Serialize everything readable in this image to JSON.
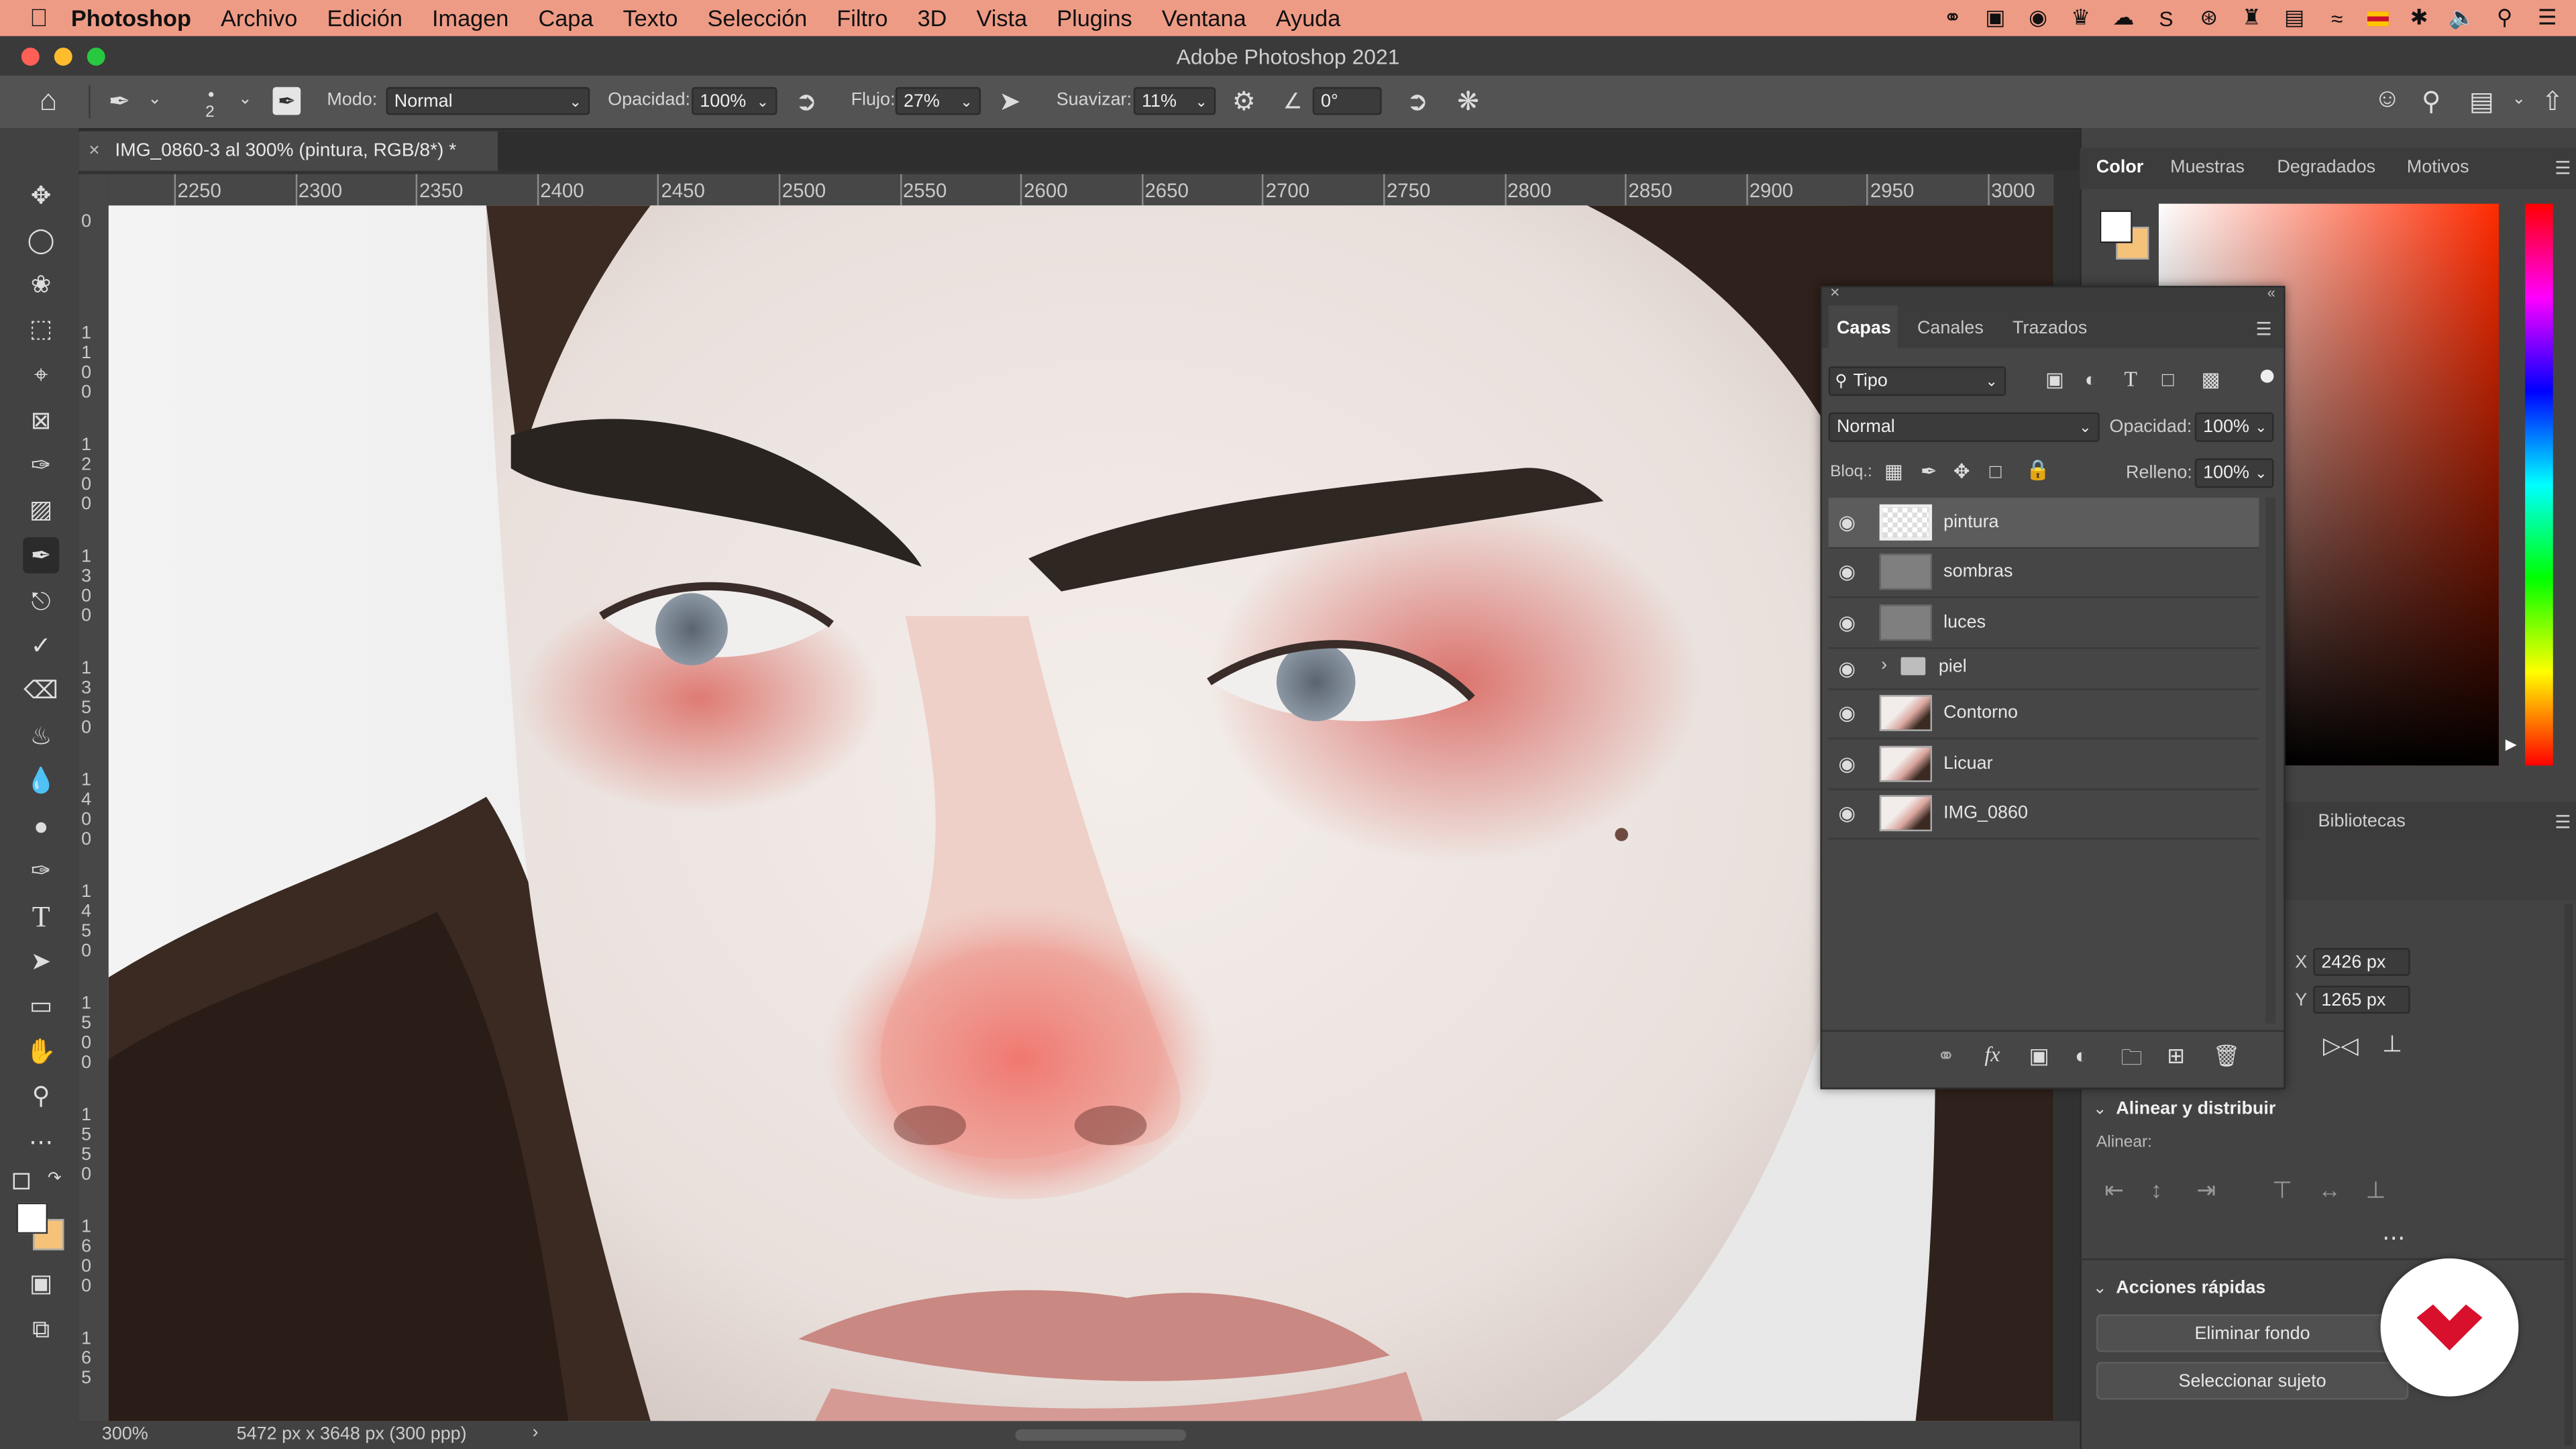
{
  "menubar": {
    "app_name": "Photoshop",
    "items": [
      "Archivo",
      "Edición",
      "Imagen",
      "Capa",
      "Texto",
      "Selección",
      "Filtro",
      "3D",
      "Vista",
      "Plugins",
      "Ventana",
      "Ayuda"
    ]
  },
  "window": {
    "title": "Adobe Photoshop 2021"
  },
  "options": {
    "brush_size": "2",
    "mode_label": "Modo:",
    "mode_value": "Normal",
    "opacity_label": "Opacidad:",
    "opacity_value": "100%",
    "flow_label": "Flujo:",
    "flow_value": "27%",
    "smoothing_label": "Suavizar:",
    "smoothing_value": "11%",
    "angle_value": "0°"
  },
  "document": {
    "tab_title": "IMG_0860-3 al 300% (pintura, RGB/8*) *",
    "zoom": "300%",
    "dimensions": "5472 px x 3648 px (300 ppp)"
  },
  "ruler": {
    "h_labels": [
      "2250",
      "2300",
      "2350",
      "2400",
      "2450",
      "2500",
      "2550",
      "2600",
      "2650",
      "2700",
      "2750",
      "2800",
      "2850",
      "2900",
      "2950",
      "3000"
    ],
    "v_labels": [
      [
        "0"
      ],
      [
        "1",
        "1",
        "0",
        "0"
      ],
      [
        "1",
        "2",
        "0",
        "0"
      ],
      [
        "1",
        "3",
        "0",
        "0"
      ],
      [
        "1",
        "3",
        "5",
        "0"
      ],
      [
        "1",
        "4",
        "0",
        "0"
      ],
      [
        "1",
        "4",
        "5",
        "0"
      ],
      [
        "1",
        "5",
        "0",
        "0"
      ],
      [
        "1",
        "5",
        "5",
        "0"
      ],
      [
        "1",
        "6",
        "0",
        "0"
      ],
      [
        "1",
        "6",
        "5"
      ]
    ]
  },
  "color_panel": {
    "tabs": [
      "Color",
      "Muestras",
      "Degradados",
      "Motivos"
    ],
    "foreground": "#ffffff",
    "background": "#f5c27a"
  },
  "layers_panel": {
    "tabs": [
      "Capas",
      "Canales",
      "Trazados"
    ],
    "filter_label": "Tipo",
    "blend_mode": "Normal",
    "opacity_label": "Opacidad:",
    "opacity_value": "100%",
    "lock_label": "Bloq.:",
    "fill_label": "Relleno:",
    "fill_value": "100%",
    "layers": [
      {
        "name": "pintura",
        "kind": "transparent",
        "selected": true
      },
      {
        "name": "sombras",
        "kind": "gray",
        "selected": false
      },
      {
        "name": "luces",
        "kind": "gray",
        "selected": false
      },
      {
        "name": "piel",
        "kind": "group",
        "selected": false
      },
      {
        "name": "Contorno",
        "kind": "photo",
        "selected": false
      },
      {
        "name": "Licuar",
        "kind": "photo",
        "selected": false
      },
      {
        "name": "IMG_0860",
        "kind": "photo",
        "selected": false
      }
    ]
  },
  "properties": {
    "libraries_tab": "Bibliotecas",
    "x_label": "X",
    "x_value": "2426 px",
    "y_label": "Y",
    "y_value": "1265 px",
    "align_section": "Alinear y distribuir",
    "align_label": "Alinear:",
    "quick_actions": "Acciones rápidas",
    "remove_bg": "Eliminar fondo",
    "select_subject": "Seleccionar sujeto"
  },
  "colors": {
    "menubar_bg": "#ee9b86",
    "brand_red": "#d9102c"
  }
}
